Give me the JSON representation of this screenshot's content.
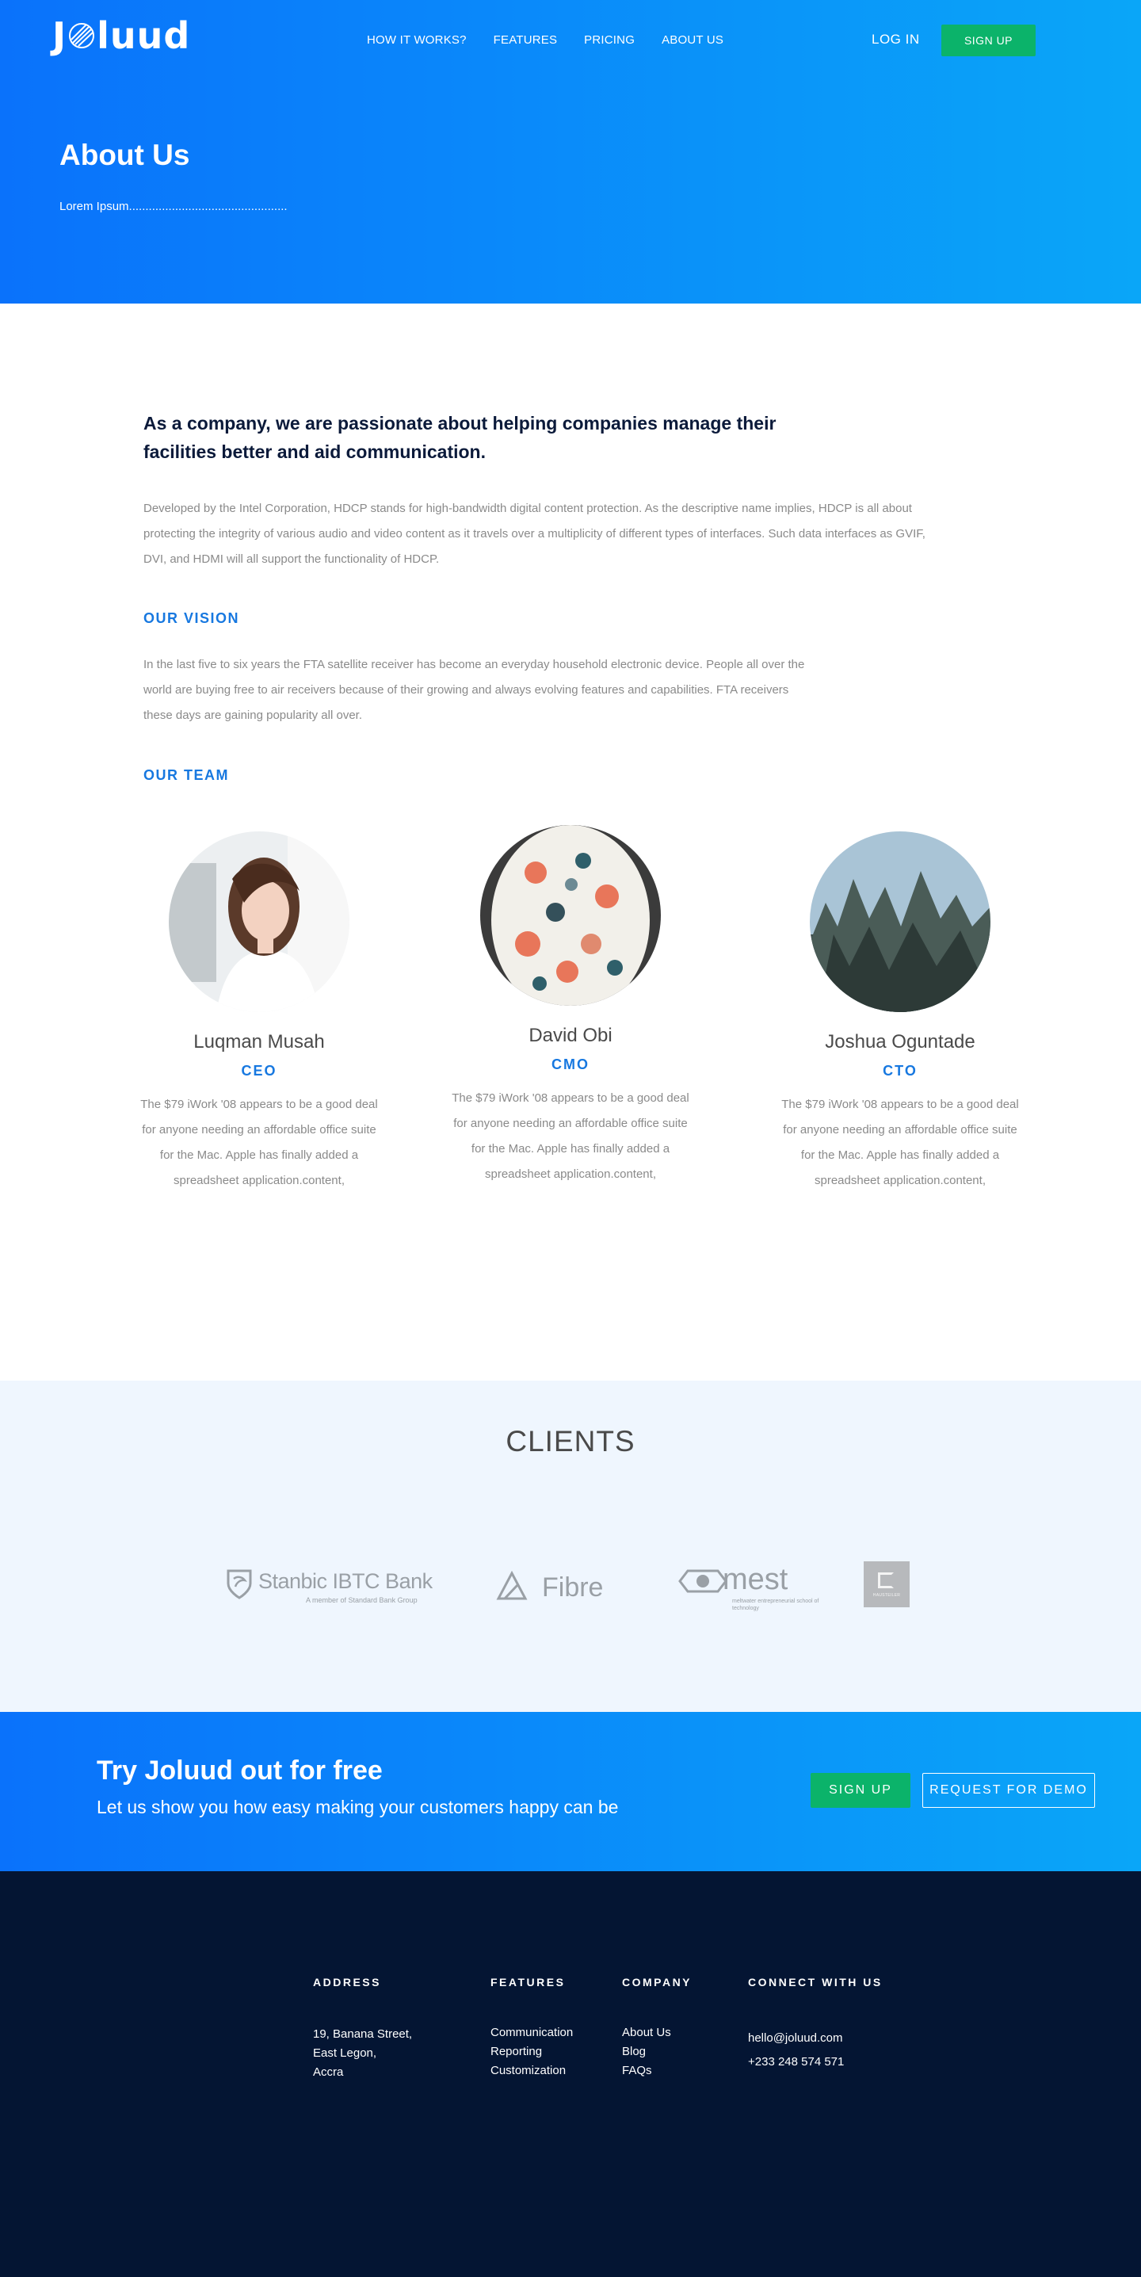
{
  "brand": {
    "logo_pre": "J",
    "logo_post": "luud",
    "accent_green": "#0bb36a",
    "accent_blue": "#1778e0",
    "hero_gradient": [
      "#0a72fb",
      "#0aa6f8"
    ],
    "footer_bg": "#041533"
  },
  "nav": {
    "items": [
      "HOW IT WORKS?",
      "FEATURES",
      "PRICING",
      "ABOUT US"
    ],
    "login": "LOG IN",
    "signup": "SIGN UP"
  },
  "hero": {
    "title": "About Us",
    "breadcrumb": "Lorem Ipsum................................................"
  },
  "about": {
    "lead": "As a company, we are passionate about helping companies manage their facilities better and aid communication.",
    "paragraph": "Developed by the Intel Corporation, HDCP stands for high-bandwidth digital content protection. As the descriptive name implies, HDCP is all about protecting the integrity of various audio and video content as it travels over a multiplicity of different types of interfaces. Such data interfaces as GVIF, DVI, and HDMI will all support the functionality of HDCP.",
    "vision_title": "OUR VISION",
    "vision_text": "In the last five to six years the FTA satellite receiver has become an everyday household electronic device. People all over the world are buying free to air receivers because of their growing and always evolving features and capabilities. FTA receivers these days are gaining popularity all over.",
    "team_title": "OUR TEAM"
  },
  "team": [
    {
      "name": "Luqman Musah",
      "role": "CEO",
      "bio": "The $79 iWork '08 appears to be a good deal for anyone needing an affordable office suite for the Mac. Apple has finally added a spreadsheet application.content,"
    },
    {
      "name": "David Obi",
      "role": "CMO",
      "bio": "The $79 iWork '08 appears to be a good deal for anyone needing an affordable office suite for the Mac. Apple has finally added a spreadsheet application.content,"
    },
    {
      "name": "Joshua Oguntade",
      "role": "CTO",
      "bio": "The $79 iWork '08 appears to be a good deal for anyone needing an affordable office suite for the Mac. Apple has finally added a spreadsheet application.content,"
    }
  ],
  "clients": {
    "title": "CLIENTS",
    "logos": [
      {
        "name": "Stanbic IBTC Bank",
        "tagline": "A member of Standard Bank Group"
      },
      {
        "name": "Fibre"
      },
      {
        "name": "mest",
        "tagline": "meltwater entrepreneurial school of technology"
      },
      {
        "name": "HAUSTEILER"
      }
    ]
  },
  "cta": {
    "title": "Try Joluud out for free",
    "subtitle": "Let us show you how easy making your customers happy can be",
    "signup": "SIGN UP",
    "demo": "REQUEST FOR DEMO"
  },
  "footer": {
    "address": {
      "title": "ADDRESS",
      "lines": [
        "19, Banana Street,",
        "East Legon,",
        "Accra"
      ]
    },
    "features": {
      "title": "FEATURES",
      "items": [
        "Communication",
        "Reporting",
        "Customization"
      ]
    },
    "company": {
      "title": "COMPANY",
      "items": [
        "About Us",
        "Blog",
        "FAQs"
      ]
    },
    "connect": {
      "title": "CONNECT WITH US",
      "email": "hello@joluud.com",
      "phone": "+233 248 574 571"
    }
  }
}
